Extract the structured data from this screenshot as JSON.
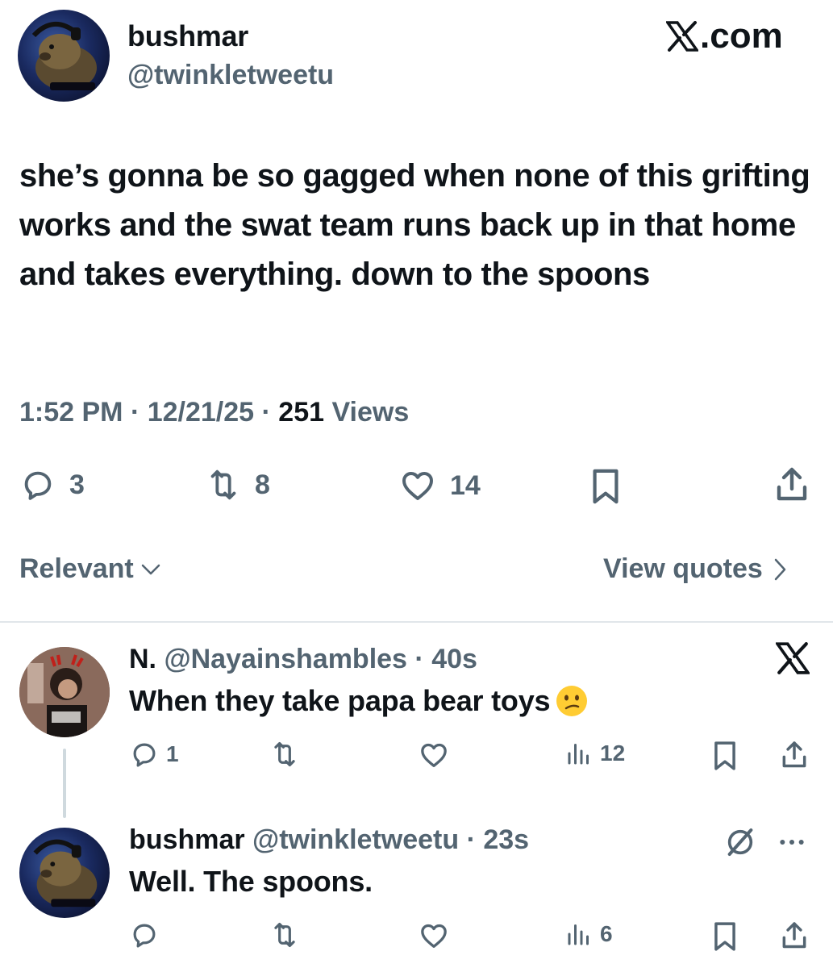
{
  "tweet": {
    "author": {
      "name": "bushmar",
      "handle": "@twinkletweetu",
      "avatar_icon": "capybara-avatar"
    },
    "source": {
      "brand_icon": "x-logo-icon",
      "domain": ".com"
    },
    "text": "she’s gonna be so gagged when none of this grifting works and the swat team runs back up in that home and takes everything. down to the spoons",
    "meta": {
      "time": "1:52 PM",
      "sep1": " · ",
      "date": "12/21/25",
      "sep2": " · ",
      "views_count": "251",
      "views_label": " Views"
    },
    "actions": {
      "replies": "3",
      "reposts": "8",
      "likes": "14"
    }
  },
  "sort": {
    "label": "Relevant",
    "icon": "chevron-down-icon"
  },
  "view_quotes": {
    "label": "View quotes",
    "icon": "chevron-right-icon"
  },
  "replies": [
    {
      "name": "N.",
      "handle": "@Nayainshambles",
      "sep": " · ",
      "time": "40s",
      "text": "When they take papa bear toys",
      "emoji": "confused-face-emoji",
      "actions": {
        "replies": "1",
        "reposts": "",
        "likes": "",
        "views": "12"
      }
    },
    {
      "name": "bushmar",
      "handle": "@twinkletweetu",
      "sep": " · ",
      "time": "23s",
      "text": "Well. The spoons.",
      "actions": {
        "replies": "",
        "reposts": "",
        "likes": "",
        "views": "6"
      }
    }
  ],
  "colors": {
    "text": "#0f1419",
    "secondary": "#536471",
    "divider": "#e1e6ea"
  }
}
